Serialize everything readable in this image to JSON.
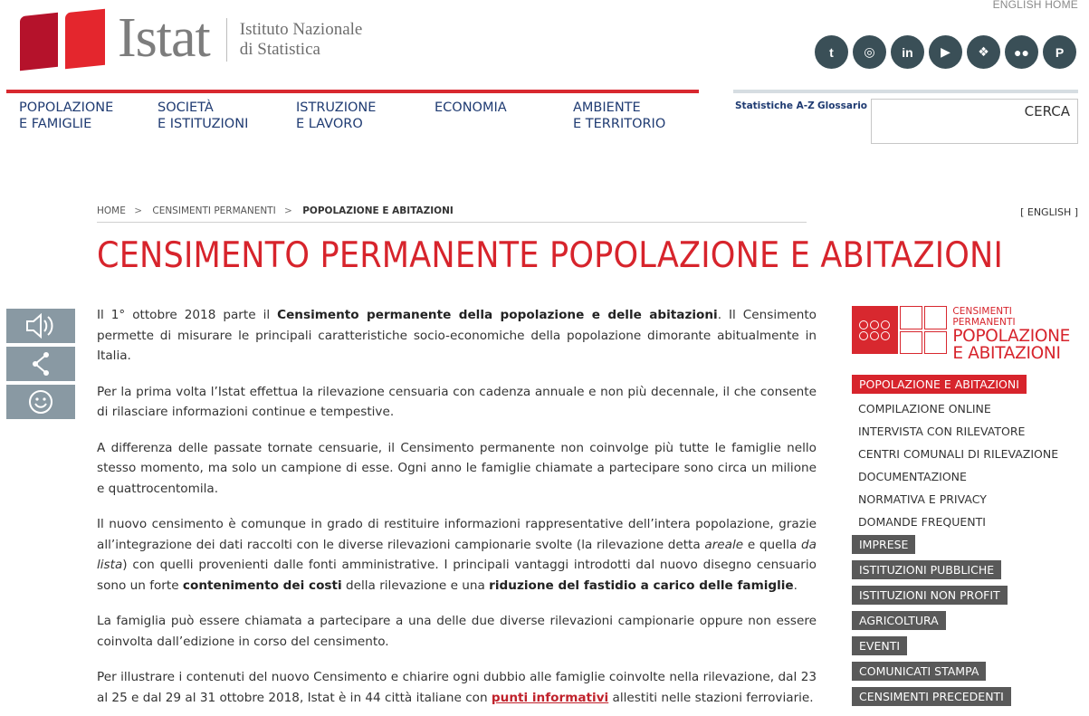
{
  "header": {
    "english_home": "ENGLISH HOME",
    "logo_word": "Istat",
    "logo_sub_1": "Istituto Nazionale",
    "logo_sub_2": "di Statistica",
    "social": [
      {
        "name": "twitter-icon",
        "glyph": "t"
      },
      {
        "name": "instagram-icon",
        "glyph": "◎"
      },
      {
        "name": "linkedin-icon",
        "glyph": "in"
      },
      {
        "name": "youtube-icon",
        "glyph": "▶"
      },
      {
        "name": "slideshare-icon",
        "glyph": "❖"
      },
      {
        "name": "flickr-icon",
        "glyph": "●●"
      },
      {
        "name": "pinterest-icon",
        "glyph": "P"
      }
    ]
  },
  "nav": {
    "items": [
      {
        "line1": "POPOLAZIONE",
        "line2": "E FAMIGLIE"
      },
      {
        "line1": "SOCIETÀ",
        "line2": "E ISTITUZIONI"
      },
      {
        "line1": "ISTRUZIONE",
        "line2": "E LAVORO"
      },
      {
        "line1": "ECONOMIA",
        "line2": ""
      },
      {
        "line1": "AMBIENTE",
        "line2": "E TERRITORIO"
      }
    ],
    "statistiche": "Statistiche A-Z",
    "glossario": "Glossario",
    "search_label": "CERCA"
  },
  "breadcrumb": {
    "home": "HOME",
    "level1": "CENSIMENTI PERMANENTI",
    "current": "POPOLAZIONE E ABITAZIONI",
    "sep": ">"
  },
  "english_link": "[ ENGLISH ]",
  "page_title": "CENSIMENTO PERMANENTE POPOLAZIONE E ABITAZIONI",
  "content": {
    "p1a": "Il 1° ottobre 2018 parte il ",
    "p1b": "Censimento permanente della popolazione e delle abitazioni",
    "p1c": ". Il Censimento permette di misurare le principali caratteristiche socio-economiche della popolazione dimorante abitualmente in Italia.",
    "p2": "Per la prima volta l’Istat effettua la rilevazione censuaria con cadenza annuale e non più decennale, il che consente di rilasciare informazioni continue e tempestive.",
    "p3": "A differenza delle passate tornate censuarie, il Censimento permanente non coinvolge più tutte le famiglie nello stesso momento, ma solo un campione di esse. Ogni anno le famiglie chiamate a partecipare sono circa un milione e quattrocentomila.",
    "p4a": "Il nuovo censimento è comunque in grado di restituire informazioni rappresentative dell’intera popolazione, grazie all’integrazione dei dati raccolti con le diverse rilevazioni campionarie svolte (la rilevazione detta ",
    "p4b": "areale",
    "p4c": " e quella ",
    "p4d": "da lista",
    "p4e": ") con quelli provenienti dalle fonti amministrative. I principali vantaggi introdotti dal nuovo disegno censuario sono un forte ",
    "p4f": "contenimento dei costi",
    "p4g": " della rilevazione e una ",
    "p4h": "riduzione del fastidio a carico delle famiglie",
    "p4i": ".",
    "p5": "La famiglia può essere chiamata a partecipare a una delle due diverse rilevazioni campionarie oppure non essere coinvolta dall’edizione in corso del censimento.",
    "p6a": "Per illustrare i contenuti del nuovo Censimento e chiarire ogni dubbio alle famiglie coinvolte nella rilevazione, dal 23 al 25 e dal 29 al 31 ottobre 2018, Istat è in 44 città italiane con ",
    "p6b": "punti informativi",
    "p6c": " allestiti nelle stazioni ferroviarie."
  },
  "sidebar": {
    "logo_small": "CENSIMENTI PERMANENTI",
    "logo_line1": "POPOLAZIONE",
    "logo_line2": "E ABITAZIONI",
    "active": "POPOLAZIONE E ABITAZIONI",
    "sub": [
      "COMPILAZIONE ONLINE",
      "INTERVISTA CON RILEVATORE",
      "CENTRI COMUNALI DI RILEVAZIONE",
      "DOCUMENTAZIONE",
      "NORMATIVA E PRIVACY",
      "DOMANDE FREQUENTI"
    ],
    "cats": [
      "IMPRESE",
      "ISTITUZIONI PUBBLICHE",
      "ISTITUZIONI NON PROFIT",
      "AGRICOLTURA",
      "EVENTI",
      "COMUNICATI STAMPA",
      "CENSIMENTI PRECEDENTI"
    ]
  },
  "colors": {
    "brand_red": "#d7242c",
    "nav_blue": "#1f3b72",
    "tool_grey": "#8999a3",
    "cat_grey": "#595959"
  }
}
